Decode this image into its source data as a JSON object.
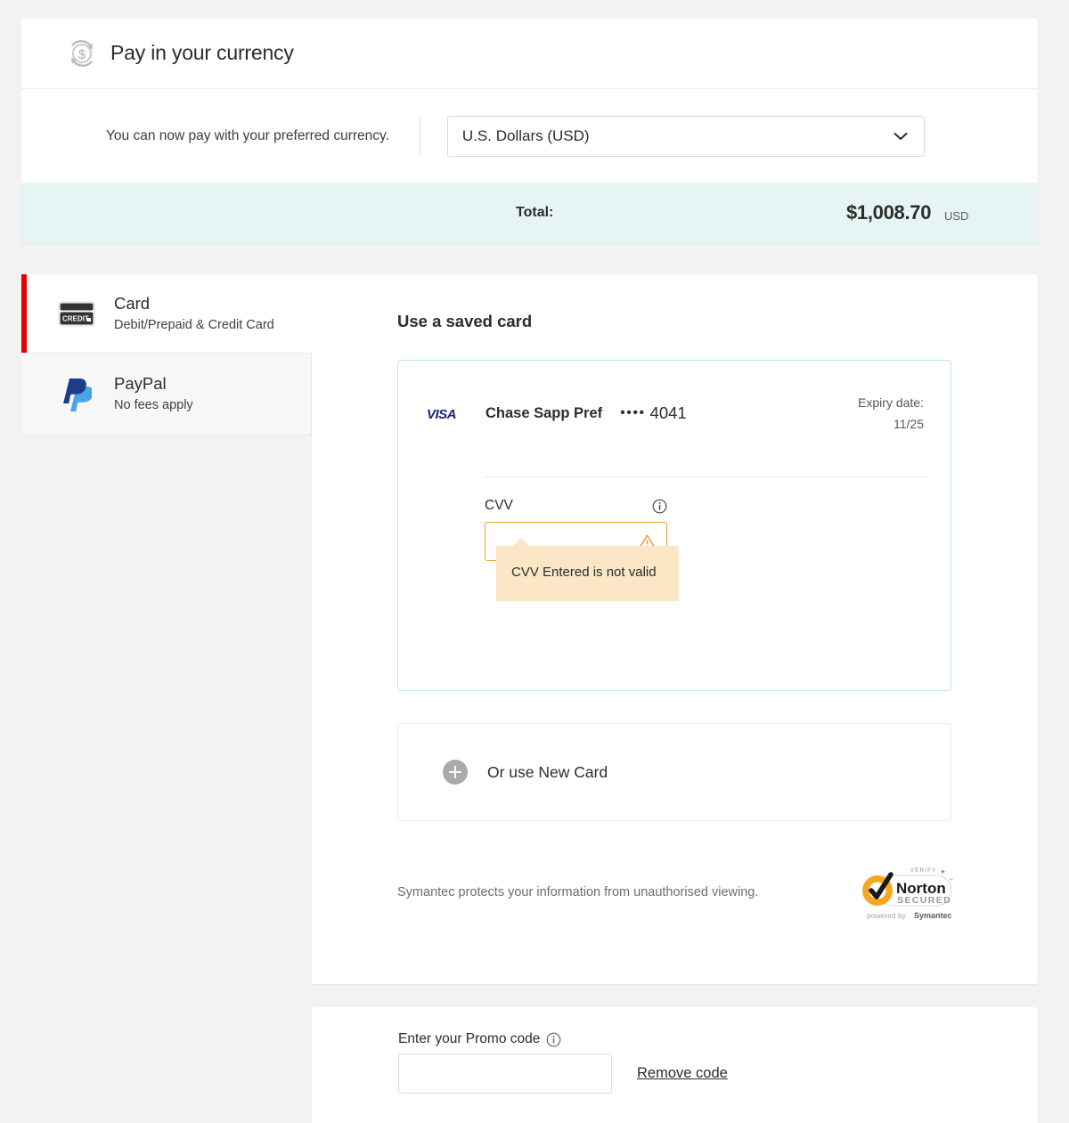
{
  "currency_section": {
    "title": "Pay in your currency",
    "icon": "currency-refresh-icon",
    "note": "You can now pay with your preferred currency.",
    "selected_currency": "U.S. Dollars (USD)",
    "chevron_icon": "chevron-down-icon",
    "total_label": "Total:",
    "total_amount": "$1,008.70",
    "total_currency_code": "USD"
  },
  "payment_methods": [
    {
      "id": "card",
      "title": "Card",
      "subtitle": "Debit/Prepaid & Credit Card",
      "icon": "credit-card-icon",
      "icon_text": "CREDIT",
      "selected": true
    },
    {
      "id": "paypal",
      "title": "PayPal",
      "subtitle": "No fees apply",
      "icon": "paypal-icon",
      "selected": false
    }
  ],
  "saved_card_section": {
    "heading": "Use a saved card",
    "card": {
      "brand_icon": "visa-logo-icon",
      "brand_text": "VISA",
      "name": "Chase Sapp Pref",
      "masked_dots": "••••",
      "last4": "4041",
      "expiry_label": "Expiry date:",
      "expiry_value": "11/25"
    },
    "cvv": {
      "label": "CVV",
      "value": "",
      "placeholder": "",
      "info_icon": "info-circle-icon",
      "warning_icon": "warning-triangle-icon",
      "error_message": "CVV Entered is not valid"
    }
  },
  "new_card": {
    "label": "Or use New Card",
    "icon": "plus-circle-icon"
  },
  "security": {
    "text": "Symantec protects your information from unauthorised viewing.",
    "badge_icon": "norton-secured-badge",
    "badge_verify": "VERIFY",
    "badge_title": "Norton",
    "badge_subtitle": "SECURED",
    "badge_powered": "powered by",
    "badge_brand": "Symantec"
  },
  "promo": {
    "label": "Enter your Promo code",
    "info_icon": "info-circle-icon",
    "value": "",
    "placeholder": "",
    "remove_link": "Remove code"
  },
  "colors": {
    "accent_red": "#e00000",
    "total_bg": "#e6f5f3",
    "card_border_teal": "#b9e5e8",
    "error_border": "#e8a33d",
    "tooltip_bg": "#fbe7c6",
    "page_bg": "#f2f2f2"
  }
}
